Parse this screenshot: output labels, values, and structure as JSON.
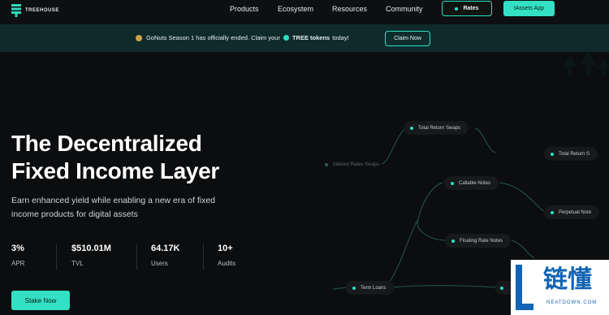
{
  "brand": {
    "name": "TREEHOUSE",
    "accent": "#34e0c4"
  },
  "nav": {
    "items": [
      "Products",
      "Ecosystem",
      "Resources",
      "Community"
    ],
    "rates_label": "Rates",
    "app_label": "tAssets App"
  },
  "banner": {
    "text_before": "GoNuts Season 1 has officially ended. Claim your",
    "text_bold": "TREE tokens",
    "text_after": "today!",
    "claim_label": "Claim Now"
  },
  "hero": {
    "title_line1": "The Decentralized",
    "title_line2": "Fixed Income Layer",
    "subtitle_line1": "Earn enhanced yield while enabling a new era of fixed",
    "subtitle_line2": "income products for digital assets",
    "stake_label": "Stake Now"
  },
  "stats": [
    {
      "value": "3%",
      "label": "APR"
    },
    {
      "value": "$510.01M",
      "label": "TVL"
    },
    {
      "value": "64.17K",
      "label": "Users"
    },
    {
      "value": "10+",
      "label": "Audits"
    }
  ],
  "diagram": {
    "nodes": {
      "total_return_swaps": "Total Return Swaps",
      "interest_rate_swaps": "Interest Rates Swaps",
      "total_return_right": "Total Return S",
      "callable_notes": "Callable Notes",
      "perpetual_notes": "Perpetual Note",
      "floating_rate_notes": "Floating Rate Notes",
      "term_loans": "Term Loans"
    }
  },
  "watermark": {
    "cn": "链懂",
    "en": "NEATDOWN.COM"
  }
}
